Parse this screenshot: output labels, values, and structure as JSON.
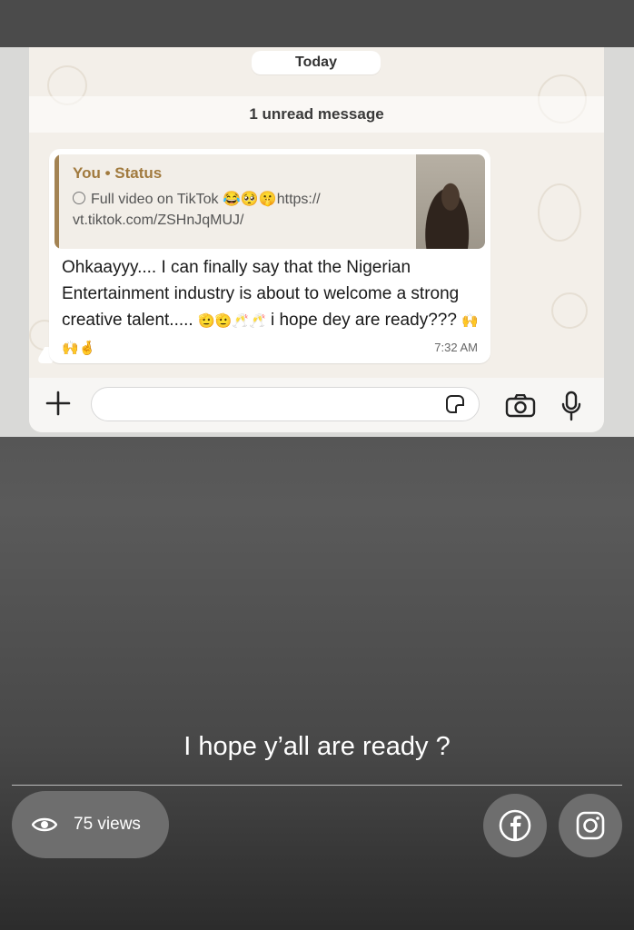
{
  "chat": {
    "date_pill": "Today",
    "unread_banner": "1 unread message",
    "message": {
      "quote_title": "You • Status",
      "quote_line1": "Full video on TikTok 😂🥺🤫https://",
      "quote_line2": "vt.tiktok.com/ZSHnJqMUJ/",
      "text_part1": "Ohkaayyy....  I can finally say that the Nigerian Entertainment industry is about to welcome a strong creative talent..... ",
      "emojis_1": "🫡🫡🥂🥂",
      "text_part2": " i hope dey are ready??? ",
      "emojis_2": "🙌🙌🤞",
      "time": "7:32 AM"
    },
    "composer": {
      "plus_icon": "plus-icon",
      "sticker_icon": "sticker-icon",
      "camera_icon": "camera-icon",
      "mic_icon": "microphone-icon"
    }
  },
  "post": {
    "caption": "I hope y’all are ready ?",
    "views": "75 views",
    "share_icons": [
      "facebook-icon",
      "instagram-icon"
    ]
  },
  "colors": {
    "status_title": "#a17a3e",
    "quote_bar": "#a38353",
    "chat_bg": "#f3efe9"
  }
}
